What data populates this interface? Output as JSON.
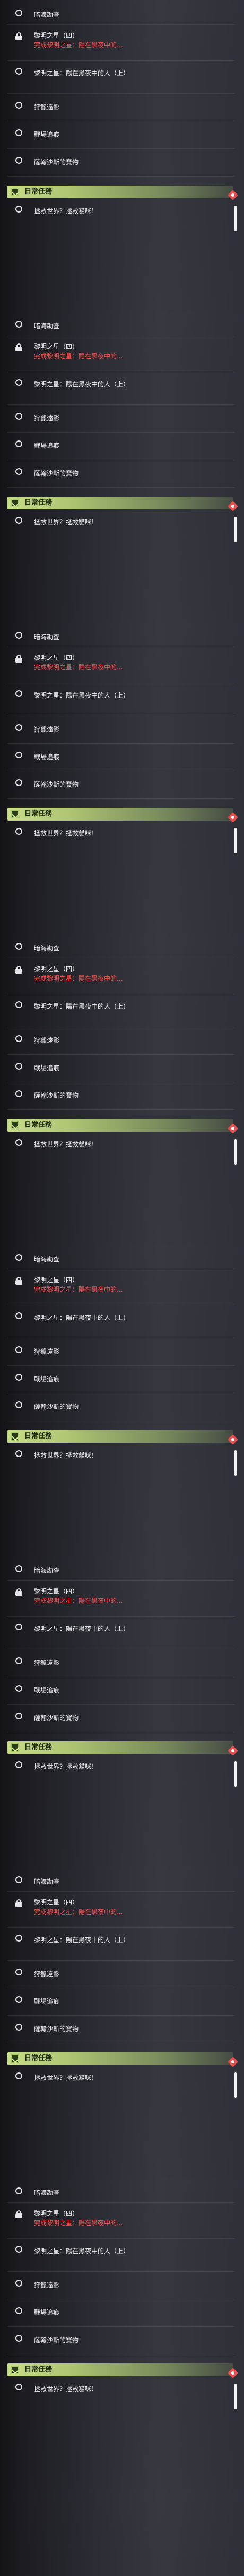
{
  "quest_panels": [
    {
      "items": [
        {
          "name": "暗海勘查",
          "desc": "",
          "icon": "circle-icon"
        },
        {
          "name": "黎明之星（四）",
          "desc": "完成黎明之星：陽在黑夜中的...",
          "icon": "lock-icon"
        },
        {
          "name": "黎明之星：陽在黑夜中的人（上）",
          "desc": "",
          "icon": "circle-icon"
        },
        {
          "name": "狩獵遠影",
          "desc": "",
          "icon": "circle-icon"
        },
        {
          "name": "戰場追痕",
          "desc": "",
          "icon": "circle-icon"
        },
        {
          "name": "薩翰沙斯的寶物",
          "desc": "",
          "icon": "circle-icon"
        },
        {
          "name": "拯救世界？拯救貓咪！",
          "desc": "",
          "icon": "circle-icon"
        }
      ],
      "daily_label": "日常任務"
    },
    {
      "items": [
        {
          "name": "暗海勘查",
          "desc": "",
          "icon": "circle-icon"
        },
        {
          "name": "黎明之星（四）",
          "desc": "完成黎明之星：陽在黑夜中的...",
          "icon": "lock-icon"
        },
        {
          "name": "黎明之星：陽在黑夜中的人（上）",
          "desc": "",
          "icon": "circle-icon"
        },
        {
          "name": "狩獵遠影",
          "desc": "",
          "icon": "circle-icon"
        },
        {
          "name": "戰場追痕",
          "desc": "",
          "icon": "circle-icon"
        },
        {
          "name": "薩翰沙斯的寶物",
          "desc": "",
          "icon": "circle-icon"
        },
        {
          "name": "拯救世界？拯救貓咪！",
          "desc": "",
          "icon": "circle-icon"
        }
      ],
      "daily_label": "日常任務"
    },
    {
      "items": [
        {
          "name": "暗海勘查",
          "desc": "",
          "icon": "circle-icon"
        },
        {
          "name": "黎明之星（四）",
          "desc": "完成黎明之星：陽在黑夜中的...",
          "icon": "lock-icon"
        },
        {
          "name": "黎明之星：陽在黑夜中的人（上）",
          "desc": "",
          "icon": "circle-icon"
        },
        {
          "name": "狩獵遠影",
          "desc": "",
          "icon": "circle-icon"
        },
        {
          "name": "戰場追痕",
          "desc": "",
          "icon": "circle-icon"
        },
        {
          "name": "薩翰沙斯的寶物",
          "desc": "",
          "icon": "circle-icon"
        },
        {
          "name": "拯救世界？拯救貓咪！",
          "desc": "",
          "icon": "circle-icon"
        }
      ],
      "daily_label": "日常任務"
    },
    {
      "items": [
        {
          "name": "暗海勘查",
          "desc": "",
          "icon": "circle-icon"
        },
        {
          "name": "黎明之星（四）",
          "desc": "完成黎明之星：陽在黑夜中的...",
          "icon": "lock-icon"
        },
        {
          "name": "黎明之星：陽在黑夜中的人（上）",
          "desc": "",
          "icon": "circle-icon"
        },
        {
          "name": "狩獵遠影",
          "desc": "",
          "icon": "circle-icon"
        },
        {
          "name": "戰場追痕",
          "desc": "",
          "icon": "circle-icon"
        },
        {
          "name": "薩翰沙斯的寶物",
          "desc": "",
          "icon": "circle-icon"
        },
        {
          "name": "拯救世界？拯救貓咪！",
          "desc": "",
          "icon": "circle-icon"
        }
      ],
      "daily_label": "日常任務"
    },
    {
      "items": [
        {
          "name": "暗海勘查",
          "desc": "",
          "icon": "circle-icon"
        },
        {
          "name": "黎明之星（四）",
          "desc": "完成黎明之星：陽在黑夜中的...",
          "icon": "lock-icon"
        },
        {
          "name": "黎明之星：陽在黑夜中的人（上）",
          "desc": "",
          "icon": "circle-icon"
        },
        {
          "name": "狩獵遠影",
          "desc": "",
          "icon": "circle-icon"
        },
        {
          "name": "戰場追痕",
          "desc": "",
          "icon": "circle-icon"
        },
        {
          "name": "薩翰沙斯的寶物",
          "desc": "",
          "icon": "circle-icon"
        },
        {
          "name": "拯救世界？拯救貓咪！",
          "desc": "",
          "icon": "circle-icon"
        }
      ],
      "daily_label": "日常任務"
    },
    {
      "items": [
        {
          "name": "暗海勘查",
          "desc": "",
          "icon": "circle-icon"
        },
        {
          "name": "黎明之星（四）",
          "desc": "完成黎明之星：陽在黑夜中的...",
          "icon": "lock-icon"
        },
        {
          "name": "黎明之星：陽在黑夜中的人（上）",
          "desc": "",
          "icon": "circle-icon"
        },
        {
          "name": "狩獵遠影",
          "desc": "",
          "icon": "circle-icon"
        },
        {
          "name": "戰場追痕",
          "desc": "",
          "icon": "circle-icon"
        },
        {
          "name": "薩翰沙斯的寶物",
          "desc": "",
          "icon": "circle-icon"
        },
        {
          "name": "拯救世界？拯救貓咪！",
          "desc": "",
          "icon": "circle-icon"
        }
      ],
      "daily_label": "日常任務"
    },
    {
      "items": [
        {
          "name": "暗海勘查",
          "desc": "",
          "icon": "circle-icon"
        },
        {
          "name": "黎明之星（四）",
          "desc": "完成黎明之星：陽在黑夜中的...",
          "icon": "lock-icon"
        },
        {
          "name": "黎明之星：陽在黑夜中的人（上）",
          "desc": "",
          "icon": "circle-icon"
        },
        {
          "name": "狩獵遠影",
          "desc": "",
          "icon": "circle-icon"
        },
        {
          "name": "戰場追痕",
          "desc": "",
          "icon": "circle-icon"
        },
        {
          "name": "薩翰沙斯的寶物",
          "desc": "",
          "icon": "circle-icon"
        },
        {
          "name": "拯救世界？拯救貓咪！",
          "desc": "",
          "icon": "circle-icon"
        }
      ],
      "daily_label": "日常任務"
    },
    {
      "items": [
        {
          "name": "暗海勘查",
          "desc": "",
          "icon": "circle-icon"
        },
        {
          "name": "黎明之星（四）",
          "desc": "完成黎明之星：陽在黑夜中的...",
          "icon": "lock-icon"
        },
        {
          "name": "黎明之星：陽在黑夜中的人（上）",
          "desc": "",
          "icon": "circle-icon"
        },
        {
          "name": "狩獵遠影",
          "desc": "",
          "icon": "circle-icon"
        },
        {
          "name": "戰場追痕",
          "desc": "",
          "icon": "circle-icon"
        },
        {
          "name": "薩翰沙斯的寶物",
          "desc": "",
          "icon": "circle-icon"
        },
        {
          "name": "拯救世界？拯救貓咪！",
          "desc": "",
          "icon": "circle-icon"
        }
      ],
      "daily_label": "日常任務"
    }
  ],
  "colors": {
    "daily_accent": "#c9e38a",
    "quest_red": "#ff4d4d",
    "badge_red": "#e55050"
  }
}
